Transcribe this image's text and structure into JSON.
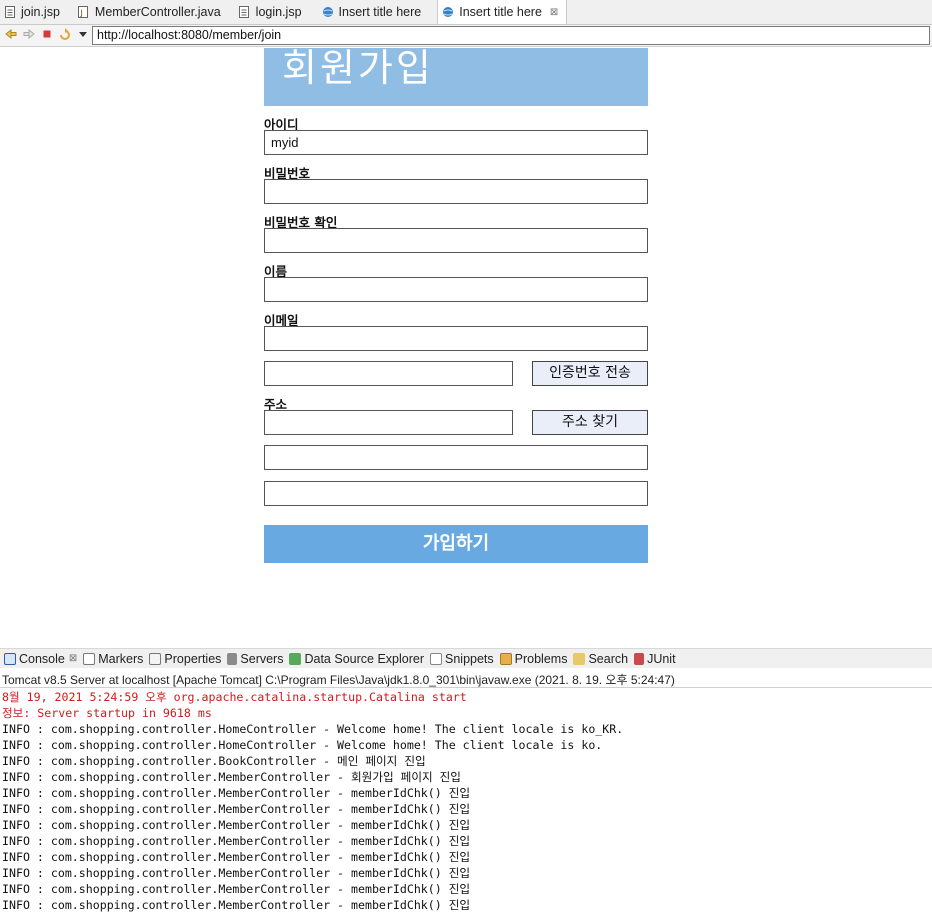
{
  "editor_tabs": [
    {
      "label": "join.jsp",
      "icon": "jsp-file-icon",
      "active": false
    },
    {
      "label": "MemberController.java",
      "icon": "java-file-icon",
      "active": false
    },
    {
      "label": "login.jsp",
      "icon": "jsp-file-icon",
      "active": false
    },
    {
      "label": "Insert title here",
      "icon": "globe-icon",
      "active": false
    },
    {
      "label": "Insert title here",
      "icon": "globe-icon",
      "active": true,
      "close": "⊠"
    }
  ],
  "browser": {
    "url": "http://localhost:8080/member/join",
    "buttons": [
      "back-icon",
      "forward-icon",
      "stop-icon",
      "refresh-icon",
      "dropdown-icon"
    ]
  },
  "form": {
    "title": "회원가입",
    "id_label": "아이디",
    "id_value": "myid",
    "password_label": "비밀번호",
    "password_confirm_label": "비밀번호 확인",
    "name_label": "이름",
    "email_label": "이메일",
    "send_code_button": "인증번호 전송",
    "address_label": "주소",
    "find_address_button": "주소 찾기",
    "submit_button": "가입하기"
  },
  "console": {
    "tabs": [
      {
        "label": "Console",
        "icon": "console-icon",
        "close": "⊠"
      },
      {
        "label": "Markers",
        "icon": "markers-icon"
      },
      {
        "label": "Properties",
        "icon": "properties-icon"
      },
      {
        "label": "Servers",
        "icon": "servers-icon"
      },
      {
        "label": "Data Source Explorer",
        "icon": "data-source-icon"
      },
      {
        "label": "Snippets",
        "icon": "snippets-icon"
      },
      {
        "label": "Problems",
        "icon": "problems-icon"
      },
      {
        "label": "Search",
        "icon": "search-icon"
      },
      {
        "label": "JUnit",
        "icon": "junit-icon"
      }
    ],
    "server_line": "Tomcat v8.5 Server at localhost [Apache Tomcat] C:\\Program Files\\Java\\jdk1.8.0_301\\bin\\javaw.exe  (2021. 8. 19. 오후 5:24:47)",
    "lines": [
      {
        "text": "8월 19, 2021 5:24:59 오후 org.apache.catalina.startup.Catalina start",
        "error": true
      },
      {
        "text": "정보: Server startup in 9618 ms",
        "error": true
      },
      {
        "text": "INFO : com.shopping.controller.HomeController - Welcome home! The client locale is ko_KR.",
        "error": false
      },
      {
        "text": "INFO : com.shopping.controller.HomeController - Welcome home! The client locale is ko.",
        "error": false
      },
      {
        "text": "INFO : com.shopping.controller.BookController - 메인 페이지 진입",
        "error": false
      },
      {
        "text": "INFO : com.shopping.controller.MemberController - 회원가입 페이지 진입",
        "error": false
      },
      {
        "text": "INFO : com.shopping.controller.MemberController - memberIdChk() 진입",
        "error": false
      },
      {
        "text": "INFO : com.shopping.controller.MemberController - memberIdChk() 진입",
        "error": false
      },
      {
        "text": "INFO : com.shopping.controller.MemberController - memberIdChk() 진입",
        "error": false
      },
      {
        "text": "INFO : com.shopping.controller.MemberController - memberIdChk() 진입",
        "error": false
      },
      {
        "text": "INFO : com.shopping.controller.MemberController - memberIdChk() 진입",
        "error": false
      },
      {
        "text": "INFO : com.shopping.controller.MemberController - memberIdChk() 진입",
        "error": false
      },
      {
        "text": "INFO : com.shopping.controller.MemberController - memberIdChk() 진입",
        "error": false
      },
      {
        "text": "INFO : com.shopping.controller.MemberController - memberIdChk() 진입",
        "error": false
      }
    ]
  },
  "colors": {
    "banner": "#8fbde4",
    "submit": "#67a9e0",
    "error_text": "#d01b1b"
  }
}
